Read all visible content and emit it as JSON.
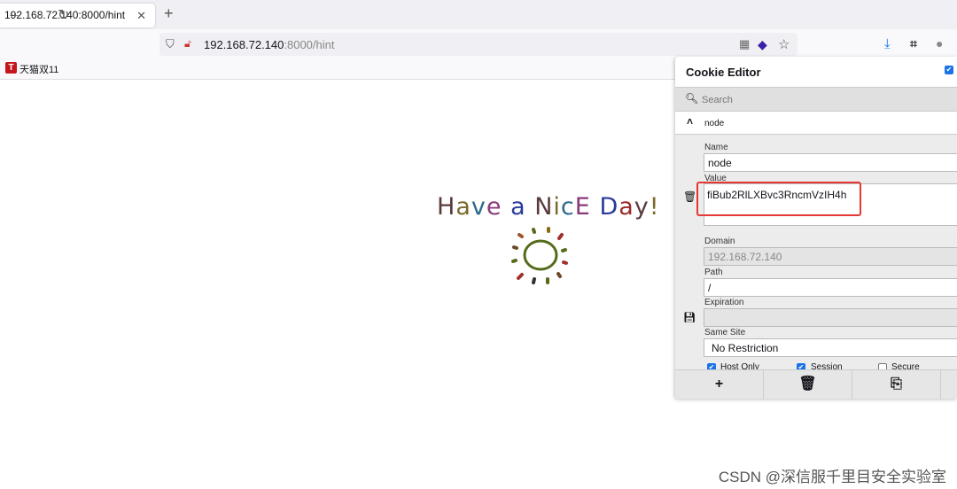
{
  "browser": {
    "tab_title": "192.168.72.140:8000/hint",
    "url_host": "192.168.72.140",
    "url_rest": ":8000/hint",
    "bookmark": "天猫双11",
    "bookmark_icon_letter": "T"
  },
  "page": {
    "heading": "Have a NicE Day!",
    "heading_colors": [
      "#5a3a3a",
      "#7a6a2a",
      "#2a6a8a",
      "#8a3a7a",
      "#3a7a3a",
      "#2a3a9a",
      "#9a2a2a"
    ]
  },
  "cookie_editor": {
    "title": "Cookie Editor",
    "search_placeholder": "Search",
    "cookie_name": "node",
    "fields": {
      "name_label": "Name",
      "name": "node",
      "value_label": "Value",
      "value": "fiBub2RlLXBvc3RncmVzIH4h",
      "domain_label": "Domain",
      "domain": "192.168.72.140",
      "path_label": "Path",
      "path": "/",
      "expiration_label": "Expiration",
      "expiration": "",
      "same_site_label": "Same Site",
      "same_site": "No Restriction"
    },
    "checkboxes": [
      {
        "label": "Host Only",
        "checked": true
      },
      {
        "label": "Session",
        "checked": true
      },
      {
        "label": "Secure",
        "checked": false
      }
    ],
    "highlight_color": "#e53935"
  },
  "watermark": "CSDN @深信服千里目安全实验室"
}
